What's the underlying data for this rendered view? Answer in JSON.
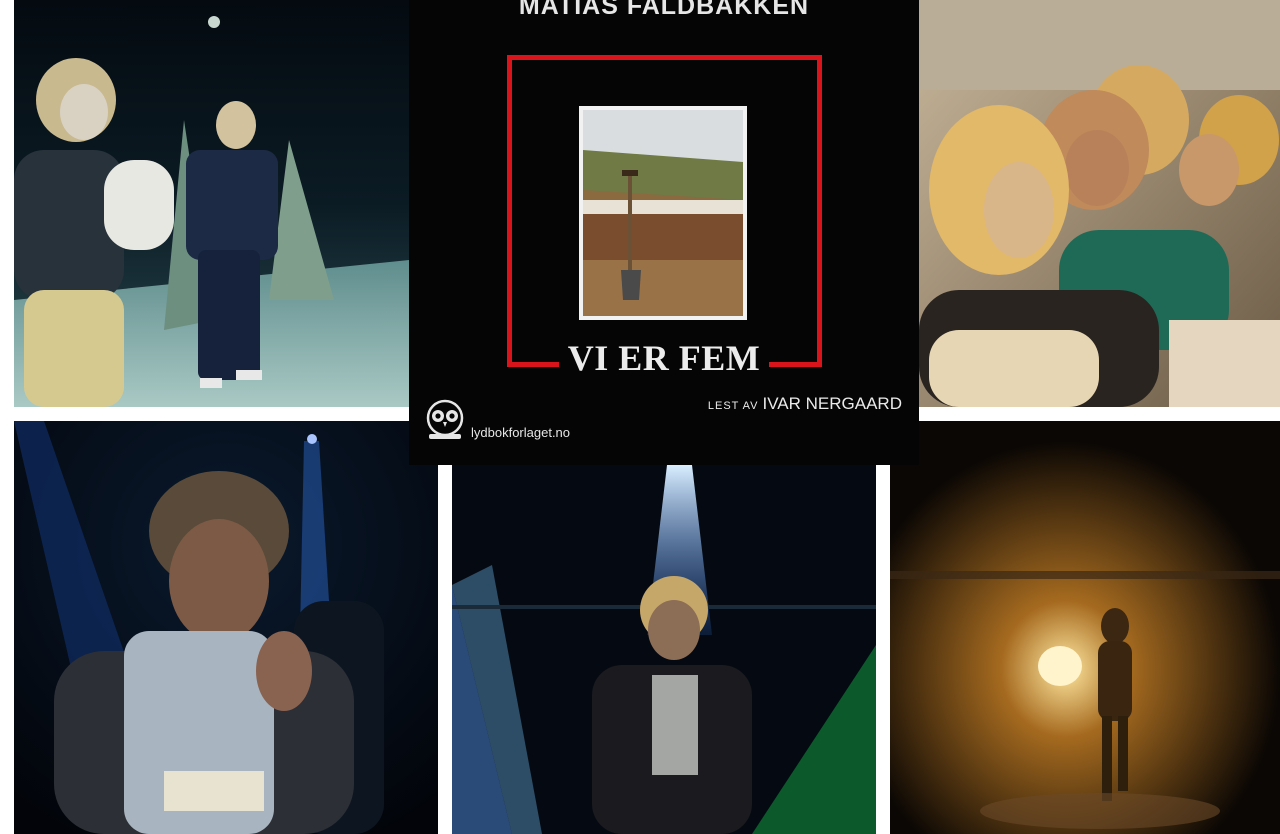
{
  "cover": {
    "author": "MATIAS FALDBAKKEN",
    "title": "VI ER FEM",
    "reader_prefix": "LEST AV",
    "reader_name": "IVAR NERGAARD",
    "publisher": "lydbokforlaget.no",
    "frame_color": "#d9141a"
  },
  "photos": [
    {
      "name": "photo-top-left",
      "scene": "two-performers-blue-stage"
    },
    {
      "name": "photo-top-right",
      "scene": "four-performers-wigs"
    },
    {
      "name": "photo-bottom-left",
      "scene": "performer-smoking-jacket"
    },
    {
      "name": "photo-bottom-middle",
      "scene": "performer-spotlight"
    },
    {
      "name": "photo-bottom-right",
      "scene": "silhouette-backlight"
    }
  ]
}
